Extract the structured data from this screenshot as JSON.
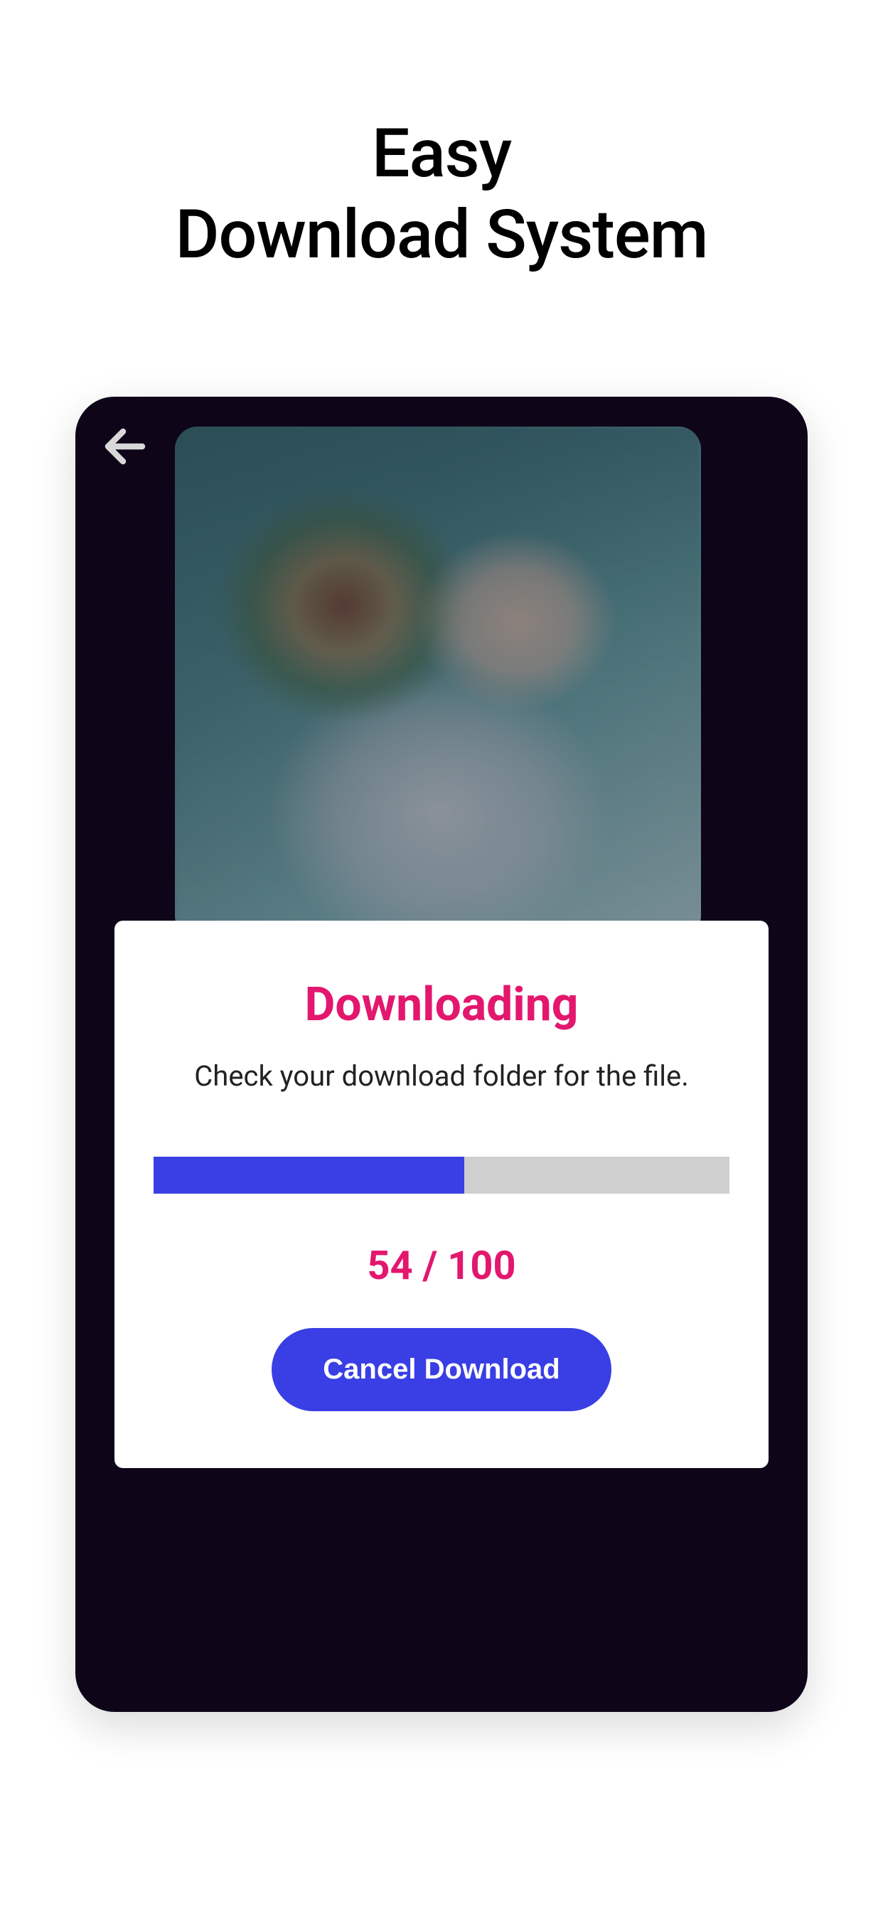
{
  "header": {
    "title_line1": "Easy",
    "title_line2": "Download System"
  },
  "modal": {
    "title": "Downloading",
    "subtitle": "Check your download folder for the file.",
    "progress_current": "54",
    "progress_total": "100",
    "progress_percent": 54,
    "cancel_label": "Cancel Download"
  },
  "colors": {
    "accent_pink": "#e3176e",
    "accent_blue": "#393fe4",
    "dark_bg": "#0e0519"
  }
}
